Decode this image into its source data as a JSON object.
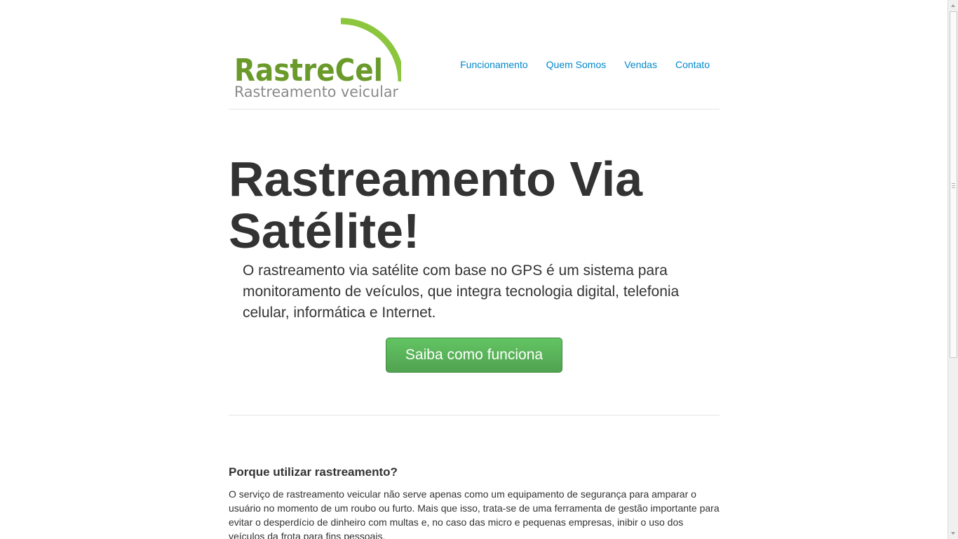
{
  "logo": {
    "brand": "RastreCel",
    "tagline": "Rastreamento veicular",
    "brand_color": "#6a9a2a",
    "arc_color": "#8cc63f",
    "tagline_color": "#8a8a8a"
  },
  "nav": {
    "items": [
      {
        "label": "Funcionamento"
      },
      {
        "label": "Quem Somos"
      },
      {
        "label": "Vendas"
      },
      {
        "label": "Contato"
      }
    ],
    "link_color": "#0088cc"
  },
  "hero": {
    "title_line1": "Rastreamento Via",
    "title_line2": "Satélite!",
    "description": "O rastreamento via satélite com base no GPS é um sistema para monitoramento de veículos, que integra tecnologia digital, telefonia celular, informática e Internet.",
    "button_label": "Saiba como funciona",
    "button_color": "#5bb75b"
  },
  "section": {
    "title": "Porque utilizar rastreamento?",
    "text": "O serviço de rastreamento veicular não serve apenas como um equipamento de segurança para amparar o usuário no momento de um roubo ou furto. Mais que isso, trata-se de uma ferramenta de gestão importante para evitar o desperdício de dinheiro com multas e, no caso das micro e pequenas empresas, inibir o uso dos veículos da frota para fins pessoais."
  }
}
